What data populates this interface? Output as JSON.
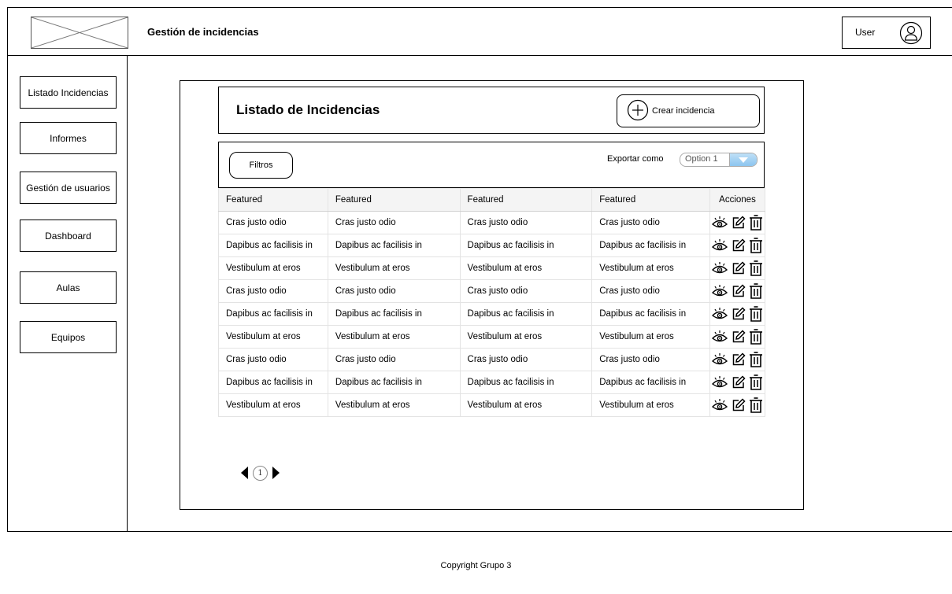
{
  "header": {
    "app_title": "Gestión de incidencias",
    "user_label": "User"
  },
  "sidebar": {
    "items": [
      {
        "label": "Listado Incidencias"
      },
      {
        "label": "Informes"
      },
      {
        "label": "Gestión de usuarios"
      },
      {
        "label": "Dashboard"
      },
      {
        "label": "Aulas"
      },
      {
        "label": "Equipos"
      }
    ]
  },
  "main": {
    "title": "Listado de Incidencias",
    "create_button": "Crear incidencia",
    "filters_button": "Filtros",
    "export_label": "Exportar como",
    "export_selected": "Option 1",
    "table": {
      "columns": [
        "Featured",
        "Featured",
        "Featured",
        "Featured",
        "Acciones"
      ],
      "rows": [
        [
          "Cras justo odio",
          "Cras justo odio",
          "Cras justo odio",
          "Cras justo odio"
        ],
        [
          "Dapibus ac facilisis in",
          "Dapibus ac facilisis in",
          "Dapibus ac facilisis in",
          "Dapibus ac facilisis in"
        ],
        [
          "Vestibulum at eros",
          "Vestibulum at eros",
          "Vestibulum at eros",
          "Vestibulum at eros"
        ],
        [
          "Cras justo odio",
          "Cras justo odio",
          "Cras justo odio",
          "Cras justo odio"
        ],
        [
          "Dapibus ac facilisis in",
          "Dapibus ac facilisis in",
          "Dapibus ac facilisis in",
          "Dapibus ac facilisis in"
        ],
        [
          "Vestibulum at eros",
          "Vestibulum at eros",
          "Vestibulum at eros",
          "Vestibulum at eros"
        ],
        [
          "Cras justo odio",
          "Cras justo odio",
          "Cras justo odio",
          "Cras justo odio"
        ],
        [
          "Dapibus ac facilisis in",
          "Dapibus ac facilisis in",
          "Dapibus ac facilisis in",
          "Dapibus ac facilisis in"
        ],
        [
          "Vestibulum at eros",
          "Vestibulum at eros",
          "Vestibulum at eros",
          "Vestibulum at eros"
        ]
      ],
      "row_actions": [
        "view-icon",
        "edit-icon",
        "trash-icon"
      ]
    },
    "pagination": {
      "current_page": "1"
    }
  },
  "footer": {
    "copyright": "Copyright Grupo 3"
  }
}
